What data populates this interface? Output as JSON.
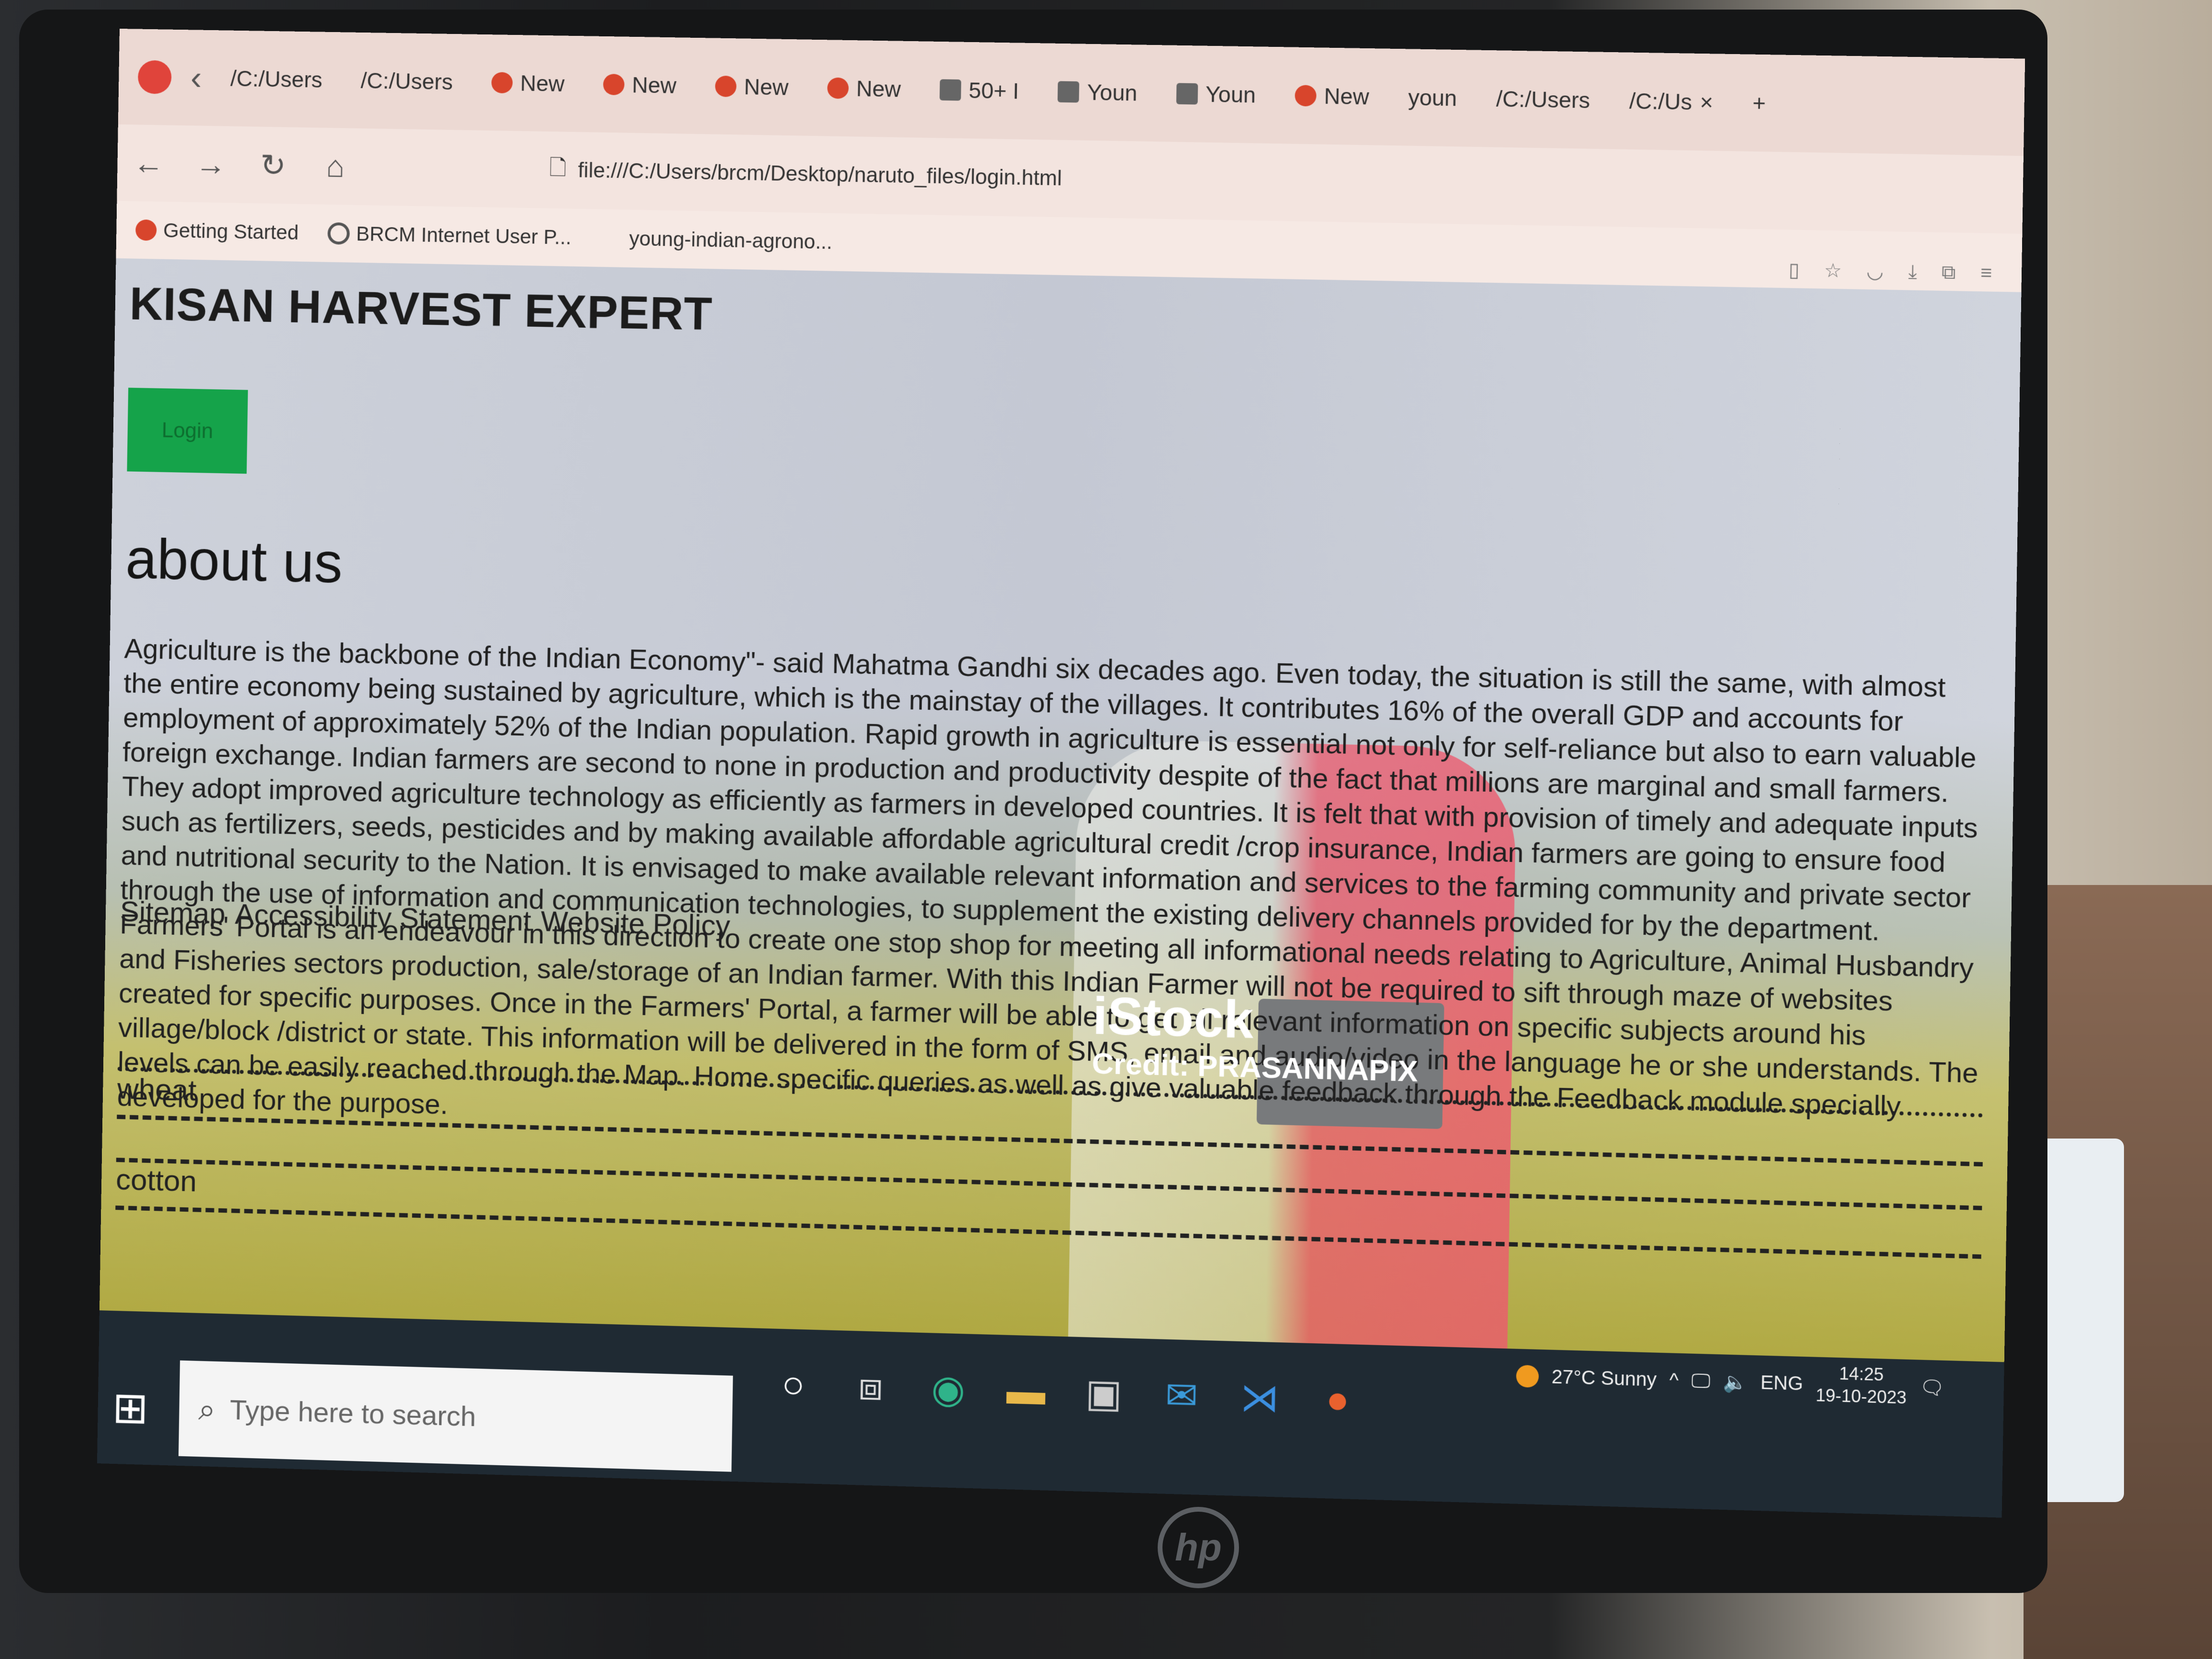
{
  "browser": {
    "tabs": [
      "/C:/Users",
      "/C:/Users",
      "New",
      "New",
      "New",
      "New",
      "50+ I",
      "Youn",
      "Youn",
      "New",
      "youn",
      "/C:/Users",
      "/C:/Us"
    ],
    "url": "file:///C:/Users/brcm/Desktop/naruto_files/login.html",
    "bookmarks": [
      "Getting Started",
      "BRCM Internet User P...",
      "young-indian-agrono..."
    ]
  },
  "page": {
    "site_title": "KISAN HARVEST EXPERT",
    "login_label": "Login",
    "about_heading": "about us",
    "about_text": "Agriculture is the backbone of the Indian Economy\"- said Mahatma Gandhi six decades ago. Even today, the situation is still the same, with almost the entire economy being sustained by agriculture, which is the mainstay of the villages. It contributes 16% of the overall GDP and accounts for employment of approximately 52% of the Indian population. Rapid growth in agriculture is essential not only for self-reliance but also to earn valuable foreign exchange. Indian farmers are second to none in production and productivity despite of the fact that millions are marginal and small farmers. They adopt improved agriculture technology as efficiently as farmers in developed countries. It is felt that with provision of timely and adequate inputs such as fertilizers, seeds, pesticides and by making available affordable agricultural credit /crop insurance, Indian farmers are going to ensure food and nutritional security to the Nation. It is envisaged to make available relevant information and services to the farming community and private sector through the use of information and communication technologies, to supplement the existing delivery channels provided for by the department. Farmers' Portal is an endeavour in this direction to create one stop shop for meeting all informational needs relating to Agriculture, Animal Husbandry and Fisheries sectors production, sale/storage of an Indian farmer. With this Indian Farmer will not be required to sift through maze of websites created for specific purposes. Once in the Farmers' Portal, a farmer will be able to get all relevant information on specific subjects around his village/block /district or state. This information will be delivered in the form of SMS, email and audio/video in the language he or she understands. The levels can be easily reached through the Map. Home specific queries as well as give valuable feedback through the Feedback module specially developed for the purpose.",
    "footer_links": [
      "Sitemap",
      "Accessibility Statement",
      "Website Policy"
    ],
    "crops": [
      "wheat",
      "cotton"
    ],
    "watermark_logo": "iStock",
    "watermark_credit": "Credit: PRASANNAPIX"
  },
  "taskbar": {
    "search_placeholder": "Type here to search",
    "weather": "27°C  Sunny",
    "language": "ENG",
    "time": "14:25",
    "date": "19-10-2023"
  }
}
